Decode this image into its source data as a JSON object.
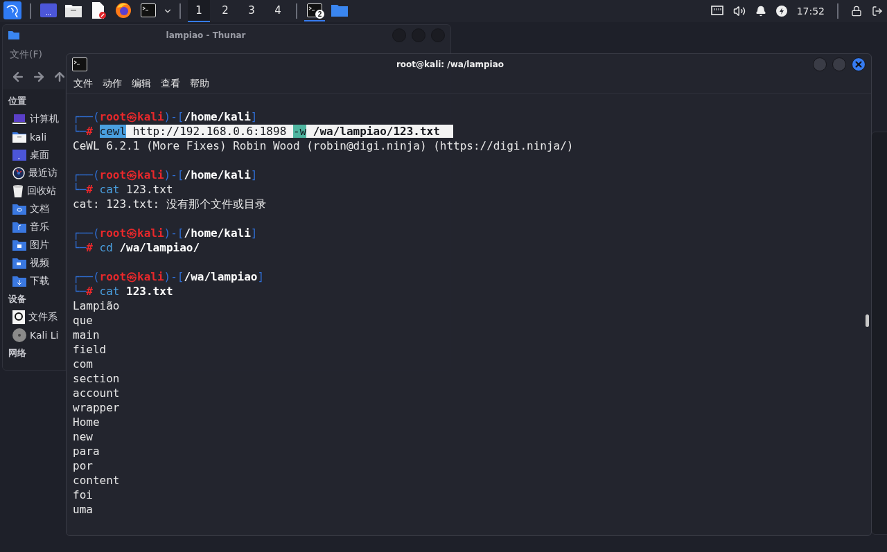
{
  "taskbar": {
    "launchers": [
      {
        "kind": "kali"
      },
      {
        "kind": "desktop"
      },
      {
        "kind": "files"
      },
      {
        "kind": "editor"
      },
      {
        "kind": "browser"
      },
      {
        "kind": "terminal"
      }
    ],
    "workspaces": [
      {
        "label": "1",
        "selected": true
      },
      {
        "label": "2",
        "selected": false
      },
      {
        "label": "3",
        "selected": false
      },
      {
        "label": "4",
        "selected": false
      }
    ],
    "tasks": [
      {
        "kind": "terminal",
        "badge": "2",
        "selected": true
      },
      {
        "kind": "folder",
        "selected": false
      }
    ],
    "clock": "17:52"
  },
  "file_manager": {
    "title": "lampiao - Thunar",
    "menu": [
      "文件(F)"
    ],
    "sidebar": [
      {
        "heading": "位置",
        "items": [
          {
            "kind": "computer",
            "label": "计算机"
          },
          {
            "kind": "home",
            "label": "kali"
          },
          {
            "kind": "desktop",
            "label": "桌面"
          },
          {
            "kind": "recent",
            "label": "最近访"
          },
          {
            "kind": "trash",
            "label": "回收站"
          },
          {
            "kind": "documents",
            "label": "文档"
          },
          {
            "kind": "music",
            "label": "音乐"
          },
          {
            "kind": "pictures",
            "label": "图片"
          },
          {
            "kind": "videos",
            "label": "视频"
          },
          {
            "kind": "downloads",
            "label": "下载"
          }
        ]
      },
      {
        "heading": "设备",
        "items": [
          {
            "kind": "drive",
            "label": "文件系"
          },
          {
            "kind": "disc",
            "label": "Kali Li"
          }
        ]
      },
      {
        "heading": "网络"
      }
    ]
  },
  "terminal": {
    "title": "root@kali: /wa/lampiao",
    "menu": [
      "文件",
      "动作",
      "编辑",
      "查看",
      "帮助"
    ],
    "lines": [
      {
        "kind": "prompt",
        "open": "┌──(",
        "user": "root",
        "at": "㉿",
        "host": "kali",
        "mid": ")-[",
        "path": "/home/kali",
        "close": "]"
      },
      {
        "kind": "command",
        "corner": "└─",
        "mark": "#",
        "tokens": [
          {
            "kind": "sel-cmd",
            "text": "cewl"
          },
          {
            "kind": "sel",
            "text": " http://192.168.0.6:1898 "
          },
          {
            "kind": "sel-opt",
            "text": "-w"
          },
          {
            "kind": "sel-bold",
            "text": " /wa/lampiao/123.txt  "
          }
        ]
      },
      {
        "kind": "output",
        "text": "CeWL 6.2.1 (More Fixes) Robin Wood (robin@digi.ninja) (https://digi.ninja/)"
      },
      {
        "kind": "blank"
      },
      {
        "kind": "prompt",
        "open": "┌──(",
        "user": "root",
        "at": "㉿",
        "host": "kali",
        "mid": ")-[",
        "path": "/home/kali",
        "close": "]"
      },
      {
        "kind": "command",
        "corner": "└─",
        "mark": "#",
        "tokens": [
          {
            "kind": "cmd",
            "text": "cat"
          },
          {
            "kind": "plain",
            "text": " 123.txt"
          }
        ]
      },
      {
        "kind": "output",
        "text": "cat: 123.txt: 没有那个文件或目录"
      },
      {
        "kind": "blank"
      },
      {
        "kind": "prompt",
        "open": "┌──(",
        "user": "root",
        "at": "㉿",
        "host": "kali",
        "mid": ")-[",
        "path": "/home/kali",
        "close": "]"
      },
      {
        "kind": "command",
        "corner": "└─",
        "mark": "#",
        "tokens": [
          {
            "kind": "cmd",
            "text": "cd"
          },
          {
            "kind": "bold",
            "text": " /wa/lampiao/"
          }
        ]
      },
      {
        "kind": "blank"
      },
      {
        "kind": "prompt",
        "open": "┌──(",
        "user": "root",
        "at": "㉿",
        "host": "kali",
        "mid": ")-[",
        "path": "/wa/lampiao",
        "close": "]"
      },
      {
        "kind": "command",
        "corner": "└─",
        "mark": "#",
        "tokens": [
          {
            "kind": "cmd",
            "text": "cat"
          },
          {
            "kind": "bold",
            "text": " 123.txt"
          }
        ]
      },
      {
        "kind": "output",
        "text": "Lampião"
      },
      {
        "kind": "output",
        "text": "que"
      },
      {
        "kind": "output",
        "text": "main"
      },
      {
        "kind": "output",
        "text": "field"
      },
      {
        "kind": "output",
        "text": "com"
      },
      {
        "kind": "output",
        "text": "section"
      },
      {
        "kind": "output",
        "text": "account"
      },
      {
        "kind": "output",
        "text": "wrapper"
      },
      {
        "kind": "output",
        "text": "Home"
      },
      {
        "kind": "output",
        "text": "new"
      },
      {
        "kind": "output",
        "text": "para"
      },
      {
        "kind": "output",
        "text": "por"
      },
      {
        "kind": "output",
        "text": "content"
      },
      {
        "kind": "output",
        "text": "foi"
      },
      {
        "kind": "output",
        "text": "uma"
      }
    ]
  }
}
